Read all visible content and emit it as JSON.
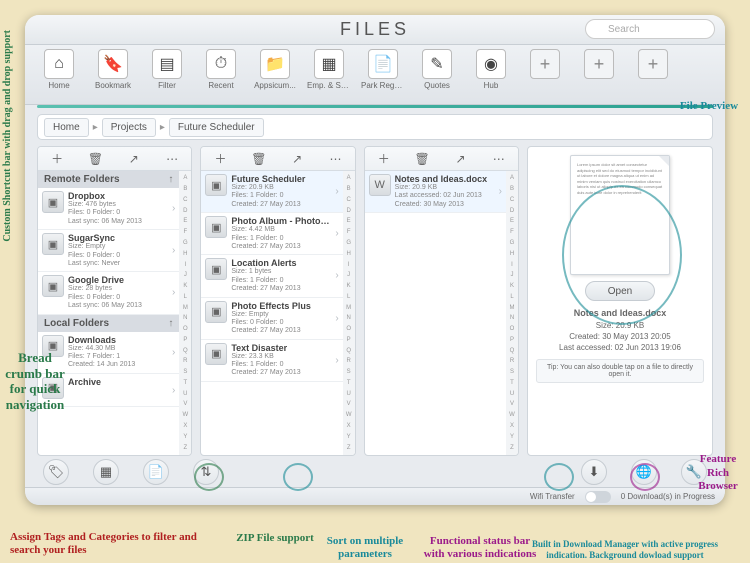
{
  "title": "FILES",
  "search": {
    "placeholder": "Search"
  },
  "toolbar": [
    {
      "name": "home",
      "label": "Home",
      "glyph": "⌂"
    },
    {
      "name": "bookmark",
      "label": "Bookmark",
      "glyph": "🔖"
    },
    {
      "name": "filter",
      "label": "Filter",
      "glyph": "▤"
    },
    {
      "name": "recent",
      "label": "Recent",
      "glyph": "⏱"
    },
    {
      "name": "appsicum",
      "label": "Appsicum...",
      "glyph": "📁"
    },
    {
      "name": "empsal",
      "label": "Emp. & Sal...",
      "glyph": "▦"
    },
    {
      "name": "parkrege",
      "label": "Park Rege...",
      "glyph": "📄"
    },
    {
      "name": "quotes",
      "label": "Quotes",
      "glyph": "✎"
    },
    {
      "name": "hub",
      "label": "Hub",
      "glyph": "◉"
    }
  ],
  "toolbar_plus_count": 3,
  "breadcrumb": [
    "Home",
    "Projects",
    "Future Scheduler"
  ],
  "index_letters": [
    "A",
    "B",
    "C",
    "D",
    "E",
    "F",
    "G",
    "H",
    "I",
    "J",
    "K",
    "L",
    "M",
    "N",
    "O",
    "P",
    "Q",
    "R",
    "S",
    "T",
    "U",
    "V",
    "W",
    "X",
    "Y",
    "Z"
  ],
  "col1": {
    "sections": [
      {
        "title": "Remote Folders",
        "items": [
          {
            "name": "Dropbox",
            "line1": "Size: 476 bytes",
            "line2": "Files: 0   Folder: 0",
            "line3": "Last sync: 06 May 2013"
          },
          {
            "name": "SugarSync",
            "line1": "Size: Empty",
            "line2": "Files: 0   Folder: 0",
            "line3": "Last sync: Never"
          },
          {
            "name": "Google Drive",
            "line1": "Size: 28 bytes",
            "line2": "Files: 0   Folder: 0",
            "line3": "Last sync: 06 May 2013"
          }
        ]
      },
      {
        "title": "Local Folders",
        "items": [
          {
            "name": "Downloads",
            "line1": "Size: 44.30 MB",
            "line2": "Files: 7   Folder: 1",
            "line3": "Created: 14 Jun 2013"
          },
          {
            "name": "Archive",
            "line1": "",
            "line2": "",
            "line3": ""
          }
        ]
      }
    ]
  },
  "col2": {
    "items": [
      {
        "name": "Future Scheduler",
        "line1": "Size: 20.9 KB",
        "line2": "Files: 1   Folder: 0",
        "line3": "Created: 27 May 2013",
        "selected": true
      },
      {
        "name": "Photo Album - Photobook",
        "line1": "Size: 4.42 MB",
        "line2": "Files: 1   Folder: 0",
        "line3": "Created: 27 May 2013"
      },
      {
        "name": "Location Alerts",
        "line1": "Size: 1 bytes",
        "line2": "Files: 1   Folder: 0",
        "line3": "Created: 27 May 2013"
      },
      {
        "name": "Photo Effects Plus",
        "line1": "Size: Empty",
        "line2": "Files: 0   Folder: 0",
        "line3": "Created: 27 May 2013"
      },
      {
        "name": "Text Disaster",
        "line1": "Size: 23.3 KB",
        "line2": "Files: 1   Folder: 0",
        "line3": "Created: 27 May 2013"
      }
    ]
  },
  "col3": {
    "items": [
      {
        "name": "Notes and Ideas.docx",
        "line1": "Size: 20.9 KB",
        "line2": "Last accessed: 02 Jun 2013",
        "line3": "Created: 30 May 2013",
        "selected": true,
        "doc": true
      }
    ]
  },
  "preview": {
    "open_label": "Open",
    "filename": "Notes and Ideas.docx",
    "size": "Size: 20.9 KB",
    "created": "Created: 30 May 2013 20:05",
    "accessed": "Last accessed: 02 Jun 2013 19:06",
    "tip": "Tip: You can also double tap on a file to directly open it."
  },
  "bottom_icons": [
    "🏷",
    "▦",
    "📄",
    "⇅",
    "",
    "⬇",
    "🌐",
    "🔧"
  ],
  "status": {
    "wifi": "Wifi Transfer",
    "downloads": "0 Download(s) in Progress"
  },
  "annotations": {
    "shortcut": "Custom Shortcut bar with drag and drop support",
    "preview": "File Preview",
    "breadcrumb": "Bread crumb bar for quick navigation",
    "tags": "Assign Tags and Categories to filter and search your files",
    "zip": "ZIP File support",
    "sort": "Sort on multiple parameters",
    "statusbar": "Functional status bar with various indications",
    "download": "Built in Download Manager with active progress indication. Background dowload support",
    "browser": "Feature Rich Browser"
  }
}
